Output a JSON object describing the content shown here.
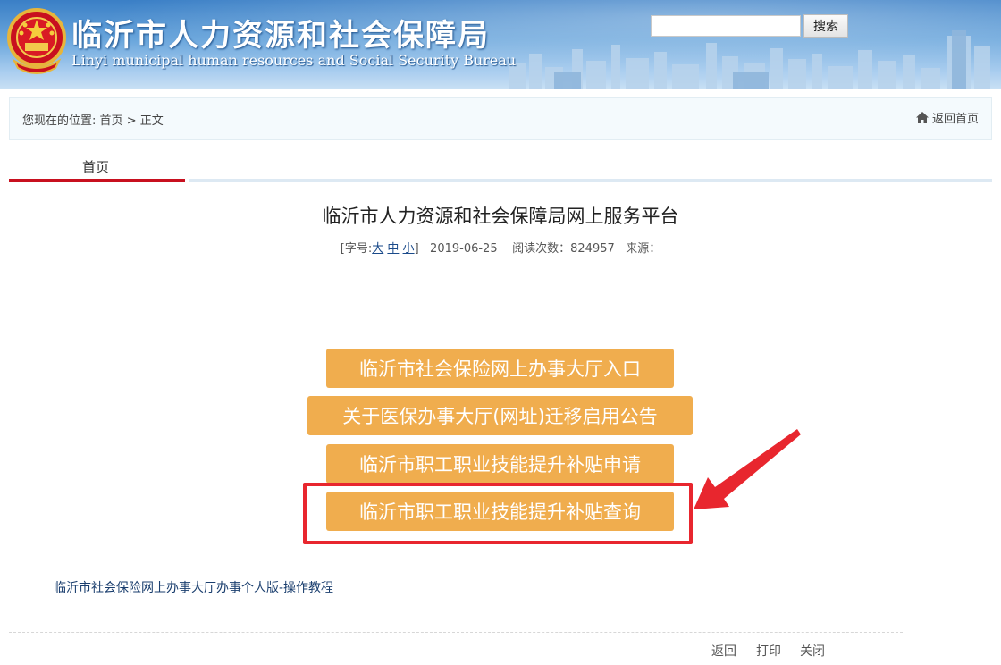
{
  "header": {
    "title": "临沂市人力资源和社会保障局",
    "subtitle": "Linyi municipal human resources and Social Security Bureau",
    "search_placeholder": "",
    "search_button": "搜索"
  },
  "breadcrumb": {
    "prefix": "您现在的位置:",
    "home": "首页",
    "sep": ">",
    "current": "正文",
    "return_home": "返回首页"
  },
  "tab": {
    "label": "首页"
  },
  "article": {
    "title": "临沂市人力资源和社会保障局网上服务平台",
    "font_size_prefix": "[字号:",
    "font_large": "大",
    "font_medium": "中",
    "font_small": "小",
    "font_size_suffix": "]",
    "date": "2019-06-25",
    "reads": "阅读次数：824957",
    "source": "来源："
  },
  "buttons": [
    {
      "label": "临沂市社会保险网上办事大厅入口"
    },
    {
      "label": "关于医保办事大厅(网址)迁移启用公告"
    },
    {
      "label": "临沂市职工职业技能提升补贴申请"
    },
    {
      "label": "临沂市职工职业技能提升补贴查询"
    }
  ],
  "tutorial_link": "临沂市社会保险网上办事大厅办事个人版-操作教程",
  "footer": {
    "back": "返回",
    "print": "打印",
    "close": "关闭"
  },
  "colors": {
    "accent_orange": "#f0ad4e",
    "highlight_red": "#e8262e",
    "tab_red": "#c8101f"
  },
  "icons": [
    "national-emblem-icon",
    "home-icon",
    "annotation-arrow-icon"
  ]
}
